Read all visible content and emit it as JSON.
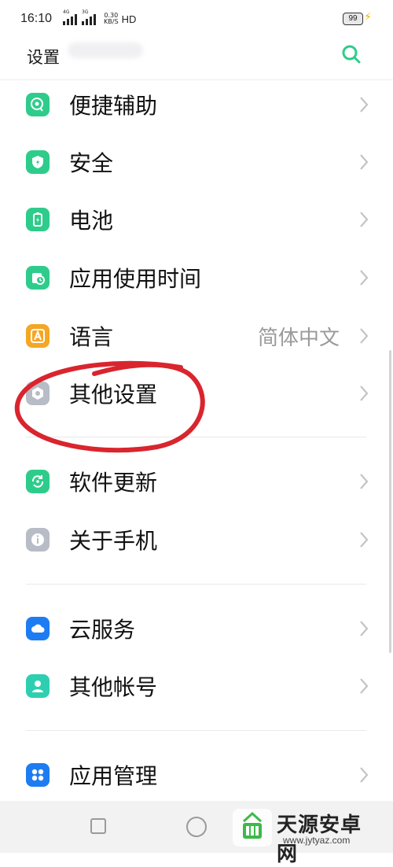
{
  "status_bar": {
    "time": "16:10",
    "signal1_tag": "4G",
    "signal2_tag": "3G",
    "net_speed_value": "0.30",
    "net_speed_unit": "KB/S",
    "hd": "HD",
    "battery": "99"
  },
  "header": {
    "title": "设置",
    "search_icon": "search-icon"
  },
  "items": [
    {
      "label": "便捷辅助",
      "icon": "assist-icon",
      "color": "#2ecc8b"
    },
    {
      "label": "安全",
      "icon": "shield-icon",
      "color": "#2ecc8b"
    },
    {
      "label": "电池",
      "icon": "battery-icon",
      "color": "#2ecc8b"
    },
    {
      "label": "应用使用时间",
      "icon": "app-time-icon",
      "color": "#2ecc8b"
    },
    {
      "label": "语言",
      "value": "简体中文",
      "icon": "language-icon",
      "color": "#f5a623"
    },
    {
      "label": "其他设置",
      "icon": "other-settings-icon",
      "color": "#b8bcc6"
    },
    {
      "label": "软件更新",
      "icon": "update-icon",
      "color": "#2ecc8b"
    },
    {
      "label": "关于手机",
      "icon": "info-icon",
      "color": "#b8bcc6"
    },
    {
      "label": "云服务",
      "icon": "cloud-icon",
      "color": "#1e7cf2"
    },
    {
      "label": "其他帐号",
      "icon": "account-icon",
      "color": "#2ecfb1"
    },
    {
      "label": "应用管理",
      "icon": "app-manage-icon",
      "color": "#1e7cf2"
    }
  ],
  "watermark": {
    "text": "天源安卓网",
    "url": "www.jytyaz.com"
  },
  "colors": {
    "accent": "#2ecc8b",
    "annotation": "#d9252e"
  }
}
